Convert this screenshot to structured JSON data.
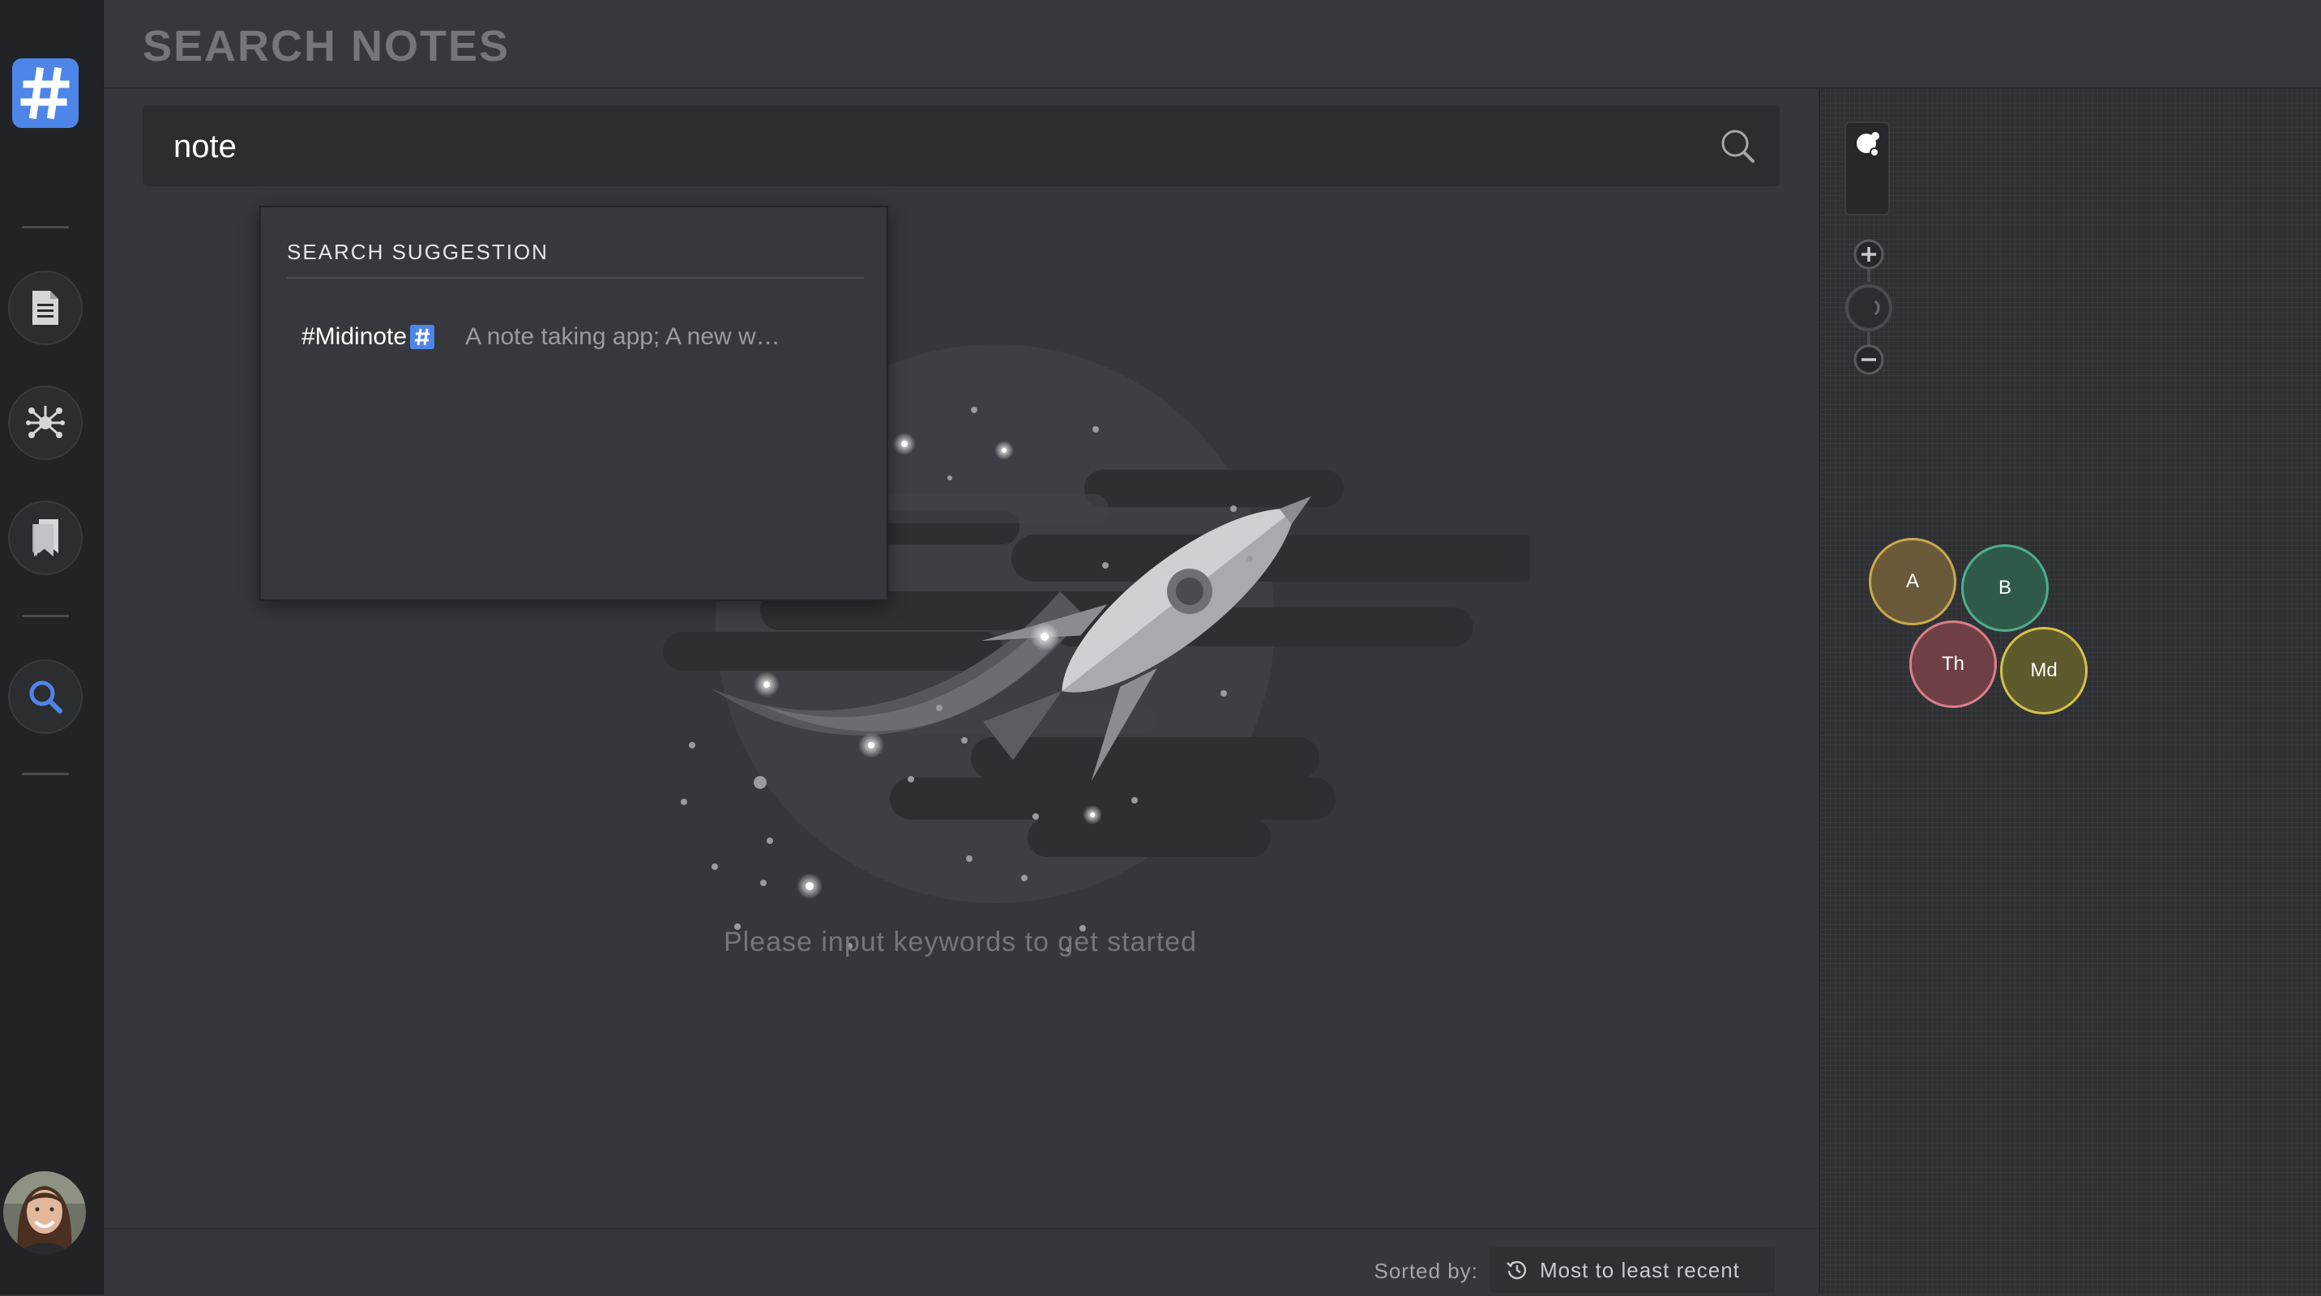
{
  "header": {
    "title": "SEARCH NOTES"
  },
  "sidebar": {
    "logo_icon": "hash-logo-icon",
    "items": [
      {
        "name": "notes",
        "icon": "document-icon"
      },
      {
        "name": "graph",
        "icon": "network-graph-icon"
      },
      {
        "name": "bookmarks",
        "icon": "bookmarks-icon"
      },
      {
        "name": "search",
        "icon": "search-icon",
        "active": true
      }
    ],
    "avatar": "user-avatar"
  },
  "search": {
    "value": "note",
    "placeholder": ""
  },
  "suggestions": {
    "title": "SEARCH SUGGESTION",
    "items": [
      {
        "tag": "#Midinote",
        "description": "A note taking app; A new w…"
      }
    ]
  },
  "empty_state": {
    "message": "Please input keywords to get started"
  },
  "footer": {
    "sorted_label": "Sorted by:",
    "sort_value": "Most to least recent"
  },
  "graph": {
    "nodes": [
      {
        "label": "A",
        "color": "#6b5a3a",
        "border": "#c9a94c"
      },
      {
        "label": "B",
        "color": "#2f5a4a",
        "border": "#4fae8a"
      },
      {
        "label": "Th",
        "color": "#6e3f45",
        "border": "#d98088"
      },
      {
        "label": "Md",
        "color": "#5e5a2e",
        "border": "#d4c248"
      }
    ]
  },
  "colors": {
    "accent": "#4d86e8",
    "background": "#36373c",
    "sidebar": "#222326"
  }
}
